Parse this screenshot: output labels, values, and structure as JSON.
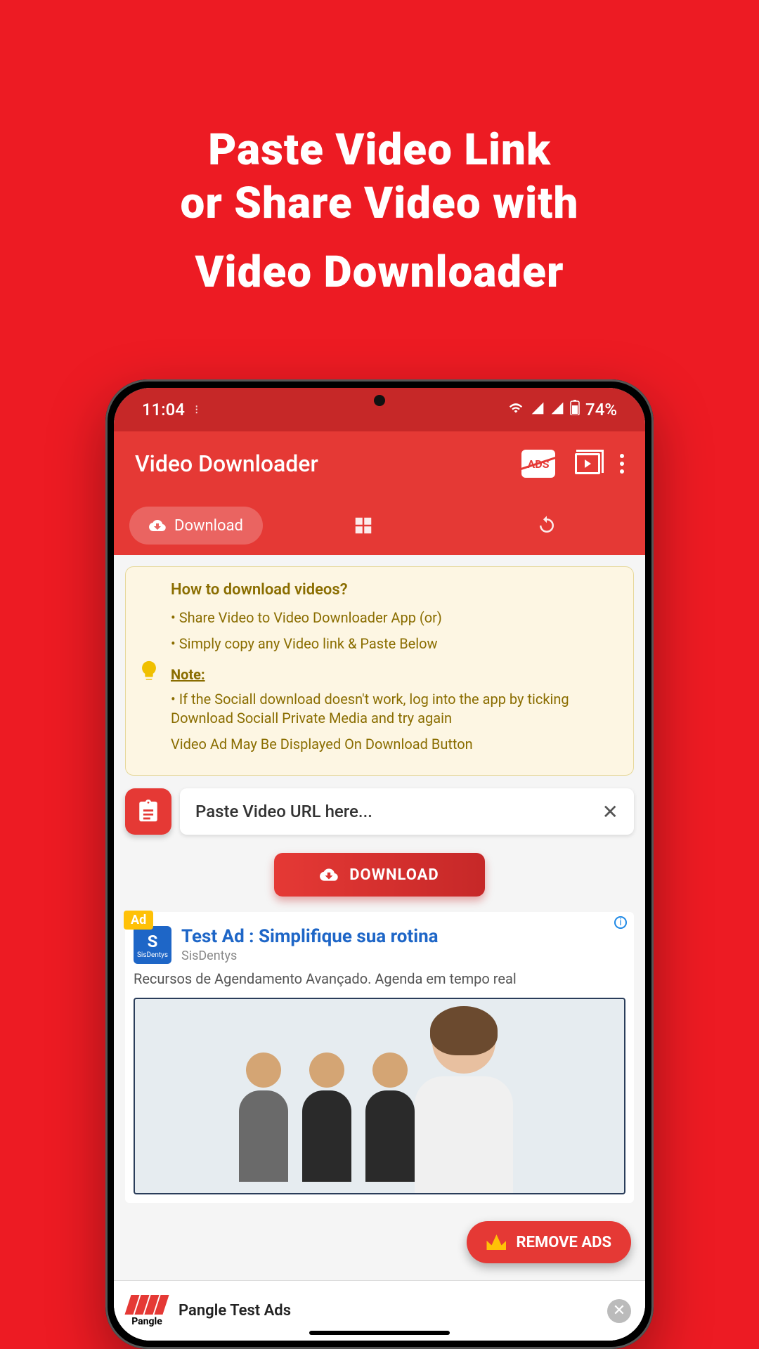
{
  "promo": {
    "line1": "Paste Video Link",
    "line2": "or Share Video with",
    "line3": "Video Downloader"
  },
  "status": {
    "time": "11:04",
    "battery": "74%"
  },
  "appbar": {
    "title": "Video Downloader",
    "ads_badge": "ADS"
  },
  "tabs": {
    "download": "Download"
  },
  "hint": {
    "title": "How to download videos?",
    "bullet1": "• Share Video to Video Downloader App (or)",
    "bullet2": "• Simply copy any Video link & Paste Below",
    "note_label": "Note:",
    "note_text": "• If the Sociall download doesn't work, log into the app by ticking Download Sociall Private Media and try again",
    "ad_notice": "Video Ad May Be Displayed On Download Button"
  },
  "url_input": {
    "placeholder": "Paste Video URL here..."
  },
  "download_button": "DOWNLOAD",
  "ad1": {
    "tag": "Ad",
    "logo_letter": "S",
    "logo_sub": "SisDentys",
    "title": "Test Ad : Simplifique sua rotina",
    "brand": "SisDentys",
    "desc": "Recursos de Agendamento Avançado. Agenda em tempo real"
  },
  "remove_ads": "REMOVE ADS",
  "ad2": {
    "brand": "Pangle",
    "text": "Pangle Test Ads"
  }
}
